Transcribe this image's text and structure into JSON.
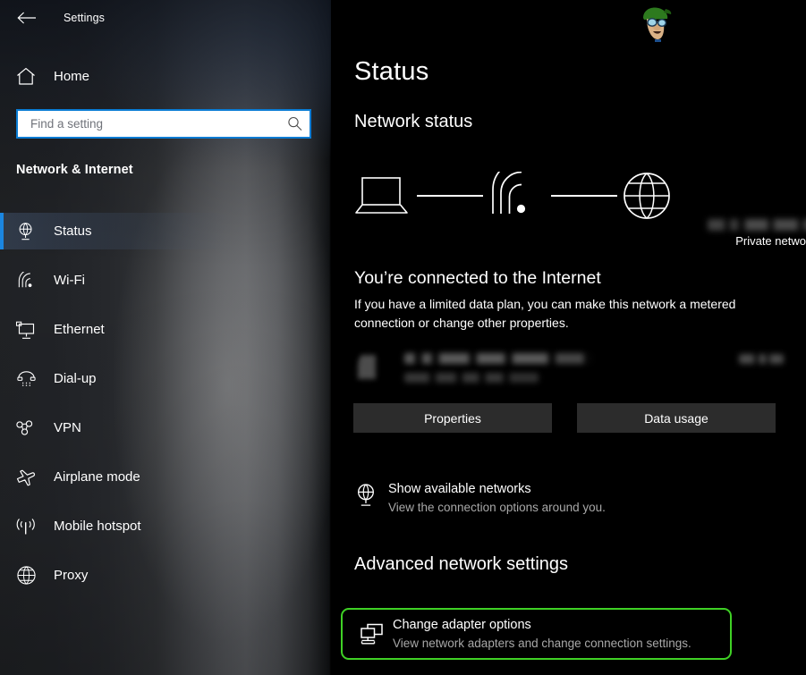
{
  "window": {
    "app_title": "Settings",
    "back_icon": "back-arrow-icon"
  },
  "sidebar": {
    "home_label": "Home",
    "home_icon": "home-icon",
    "search": {
      "placeholder": "Find a setting",
      "value": "",
      "icon": "search-icon"
    },
    "category_label": "Network & Internet",
    "items": [
      {
        "label": "Status",
        "icon": "globe-monitor-icon",
        "selected": true
      },
      {
        "label": "Wi-Fi",
        "icon": "wifi-icon",
        "selected": false
      },
      {
        "label": "Ethernet",
        "icon": "ethernet-icon",
        "selected": false
      },
      {
        "label": "Dial-up",
        "icon": "dialup-phone-icon",
        "selected": false
      },
      {
        "label": "VPN",
        "icon": "vpn-icon",
        "selected": false
      },
      {
        "label": "Airplane mode",
        "icon": "airplane-icon",
        "selected": false
      },
      {
        "label": "Mobile hotspot",
        "icon": "hotspot-icon",
        "selected": false
      },
      {
        "label": "Proxy",
        "icon": "globe-icon",
        "selected": false
      }
    ]
  },
  "main": {
    "page_title": "Status",
    "network_status_heading": "Network status",
    "diagram": {
      "device_icon": "laptop-icon",
      "connection_icon": "wifi-signal-icon",
      "internet_icon": "globe-icon",
      "network_name": "",
      "network_type": "Private network"
    },
    "connected_heading": "You’re connected to the Internet",
    "connected_description": "If you have a limited data plan, you can make this network a metered connection or change other properties.",
    "usage": {
      "network_name": "",
      "period": "",
      "amount": ""
    },
    "properties_button": "Properties",
    "data_usage_button": "Data usage",
    "show_networks": {
      "title": "Show available networks",
      "subtitle": "View the connection options around you.",
      "icon": "globe-monitor-icon"
    },
    "advanced_heading": "Advanced network settings",
    "change_adapter": {
      "title": "Change adapter options",
      "subtitle": "View network adapters and change connection settings.",
      "icon": "network-adapters-icon",
      "highlight_color": "#3fd125"
    }
  },
  "watermark": {
    "name": "site-mascot-logo"
  },
  "colors": {
    "accent_blue": "#1b86e0",
    "search_border": "#0a7cd4",
    "highlight_green": "#3fd125",
    "button_bg": "#2c2c2c",
    "main_bg": "#000000"
  }
}
